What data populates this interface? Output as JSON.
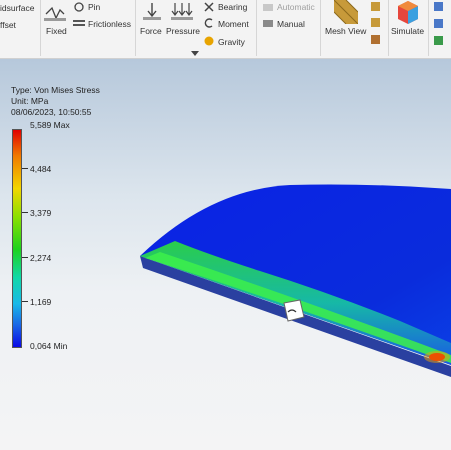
{
  "ribbon": {
    "midsurface": "idsurface",
    "offset": "ffset",
    "fixed": "Fixed",
    "pin": "Pin",
    "frictionless": "Frictionless",
    "force": "Force",
    "pressure": "Pressure",
    "bearing": "Bearing",
    "moment": "Moment",
    "gravity": "Gravity",
    "automatic": "Automatic",
    "manual": "Manual",
    "mesh_view": "Mesh View",
    "simulate": "Simulate"
  },
  "legend": {
    "type": "Type: Von Mises Stress",
    "unit": "Unit: MPa",
    "datetime": "08/06/2023, 10:50:55",
    "max": "5,589 Max",
    "v1": "4,484",
    "v2": "3,379",
    "v3": "2,274",
    "v4": "1,169",
    "min": "0,064 Min"
  },
  "colors": {
    "max": "#e10000",
    "mid": "#1ed21e",
    "min": "#0a0ae6",
    "part_main": "#0a28e6"
  },
  "icons": [
    "spring-icon",
    "pin-icon",
    "frictionless-icon",
    "force-icon",
    "pressure-icon",
    "bearing-icon",
    "moment-icon",
    "gravity-icon",
    "automatic-icon",
    "manual-icon",
    "mesh-view-icon",
    "simulate-icon",
    "view-cube-icon"
  ]
}
